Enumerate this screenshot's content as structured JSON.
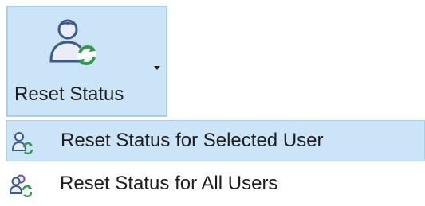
{
  "ribbon": {
    "reset_status_label": "Reset Status",
    "icon": "user-refresh-icon",
    "dropdown_icon": "chevron-down-icon"
  },
  "menu": {
    "items": [
      {
        "label": "Reset Status for Selected User",
        "icon": "user-refresh-icon",
        "selected": true
      },
      {
        "label": "Reset Status for All Users",
        "icon": "users-refresh-icon",
        "selected": false
      }
    ]
  },
  "colors": {
    "highlight_bg": "#cce4f7",
    "highlight_border": "#a9d0ef",
    "icon_blue": "#3b5b8c",
    "refresh_green": "#2e9b4f",
    "text": "#1e1e1e"
  }
}
